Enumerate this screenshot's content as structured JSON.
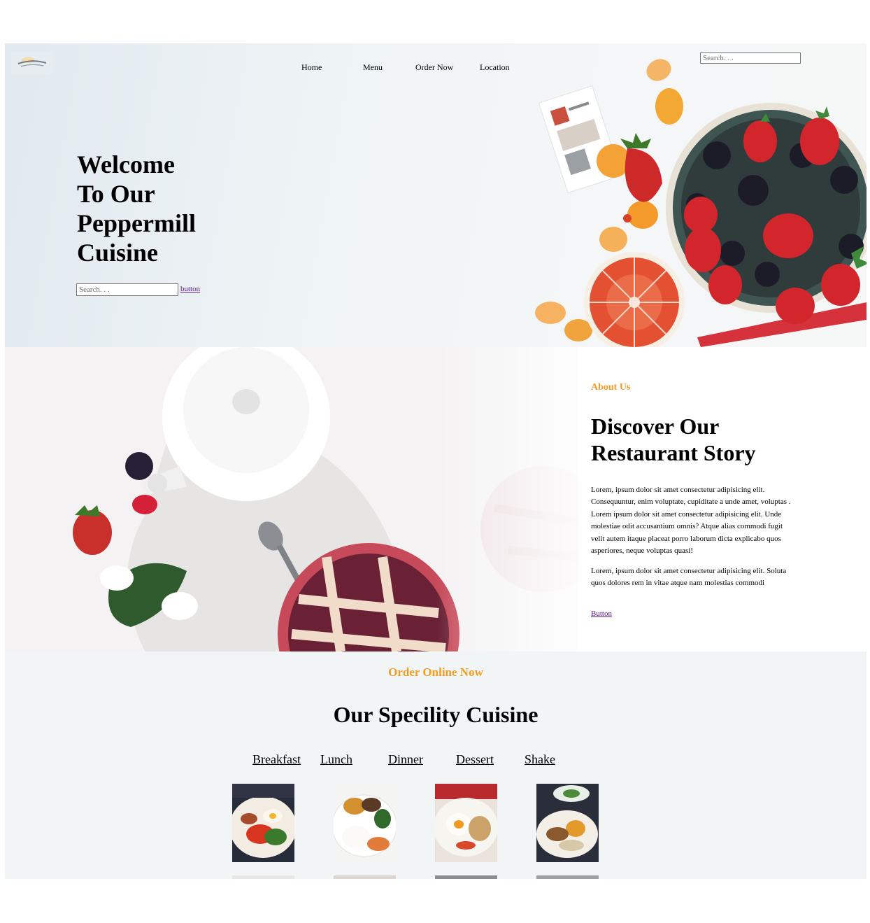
{
  "nav": {
    "items": [
      {
        "label": "Home"
      },
      {
        "label": "Menu"
      },
      {
        "label": "Order Now"
      },
      {
        "label": "Location"
      }
    ],
    "search_placeholder": "Search. . ."
  },
  "hero": {
    "title_lines": [
      "Welcome",
      "To Our",
      "Peppermill",
      "Cuisine"
    ],
    "search_placeholder": "Search. . .",
    "button_label": "button"
  },
  "about": {
    "eyebrow": "About Us",
    "title_lines": [
      "Discover Our",
      "Restaurant Story"
    ],
    "paragraph_1": "Lorem, ipsum dolor sit amet consectetur adipisicing elit. Consequuntur, enim voluptate, cupiditate a unde amet, voluptas . Lorem ipsum dolor sit amet consectetur adipisicing elit. Unde molestiae odit accusantium omnis? Atque alias commodi fugit velit autem itaque placeat porro laborum dicta explicabo quos asperiores, neque voluptas quasi!",
    "paragraph_2": "Lorem, ipsum dolor sit amet consectetur adipisicing elit. Soluta quos dolores rem in vitae atque nam molestias commodi",
    "button_label": "Button"
  },
  "cuisine": {
    "eyebrow": "Order Online Now",
    "title": "Our Specility Cuisine",
    "tabs": [
      {
        "label": "Breakfast"
      },
      {
        "label": "Lunch"
      },
      {
        "label": "Dinner"
      },
      {
        "label": "Dessert"
      },
      {
        "label": "Shake"
      }
    ],
    "dishes": [
      {
        "name": "breakfast-plate-photo"
      },
      {
        "name": "egg-toast-plate-photo"
      },
      {
        "name": "fried-egg-plate-photo"
      },
      {
        "name": "brunch-plate-photo"
      }
    ]
  },
  "colors": {
    "accent": "#f39c1f",
    "link": "#551a8b",
    "cuisine_bg": "#f1f5f6"
  }
}
